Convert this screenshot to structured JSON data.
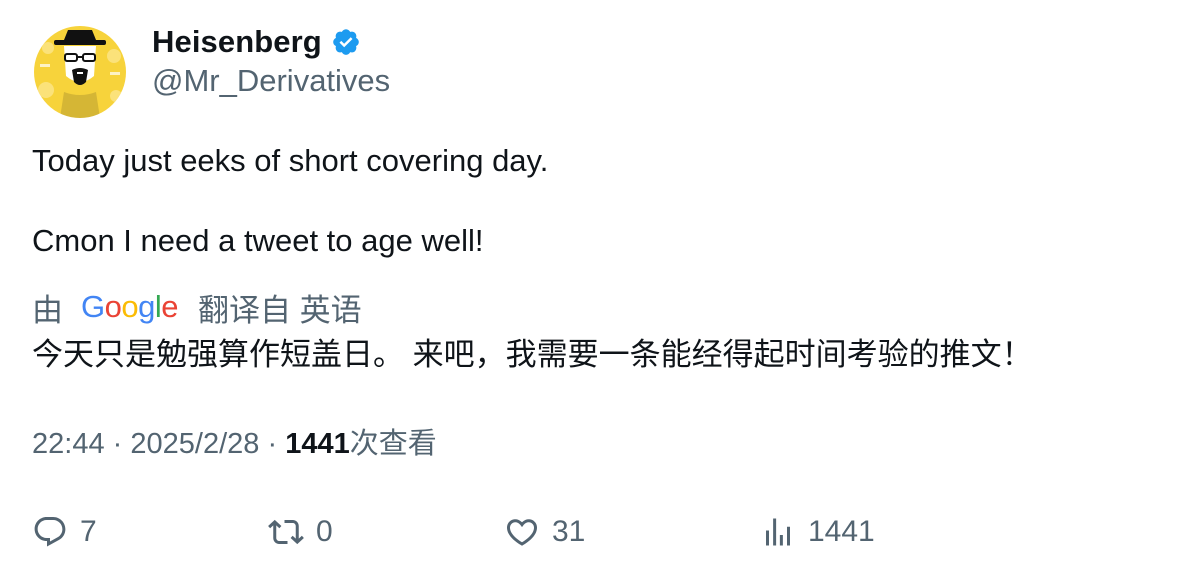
{
  "author": {
    "display_name": "Heisenberg",
    "handle": "@Mr_Derivatives",
    "verified_icon": "verified-badge-icon",
    "avatar_icon": "heisenberg-avatar"
  },
  "tweet": {
    "line1": "Today just eeks of short covering day.",
    "line2": "Cmon I need a tweet to age well!"
  },
  "translation": {
    "prefix": "由",
    "provider": "Google",
    "suffix": "翻译自 英语",
    "text": "今天只是勉强算作短盖日。 来吧，我需要一条能经得起时间考验的推文！"
  },
  "meta": {
    "time": "22:44",
    "separator": "·",
    "date": "2025/2/28",
    "views_count": "1441",
    "views_label": "次查看"
  },
  "actions": {
    "reply_count": "7",
    "retweet_count": "0",
    "like_count": "31",
    "views_count": "1441"
  },
  "colors": {
    "text_primary": "#0f1419",
    "text_secondary": "#536471",
    "verified_blue": "#1d9bf0",
    "avatar_yellow": "#f7d33b"
  }
}
